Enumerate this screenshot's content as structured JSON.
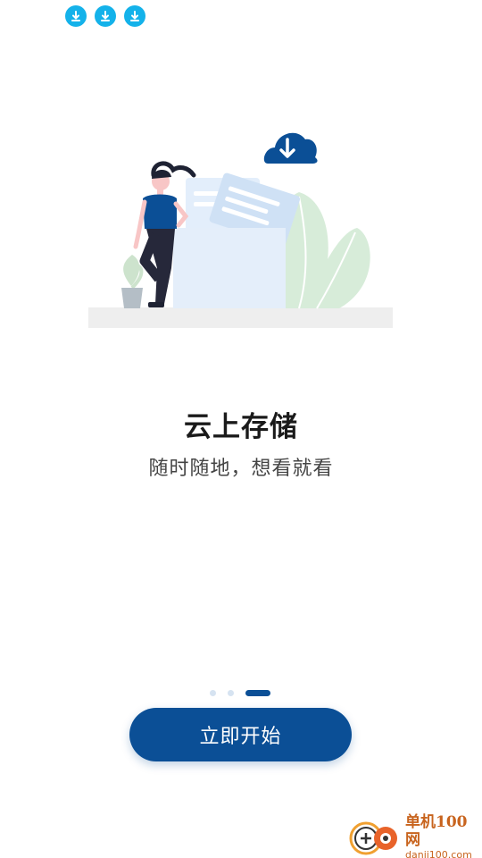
{
  "status_bar": {
    "icons": [
      "download-notification-icon",
      "download-notification-icon",
      "download-notification-icon"
    ]
  },
  "onboarding": {
    "title": "云上存储",
    "subtitle": "随时随地，想看就看",
    "page_indicator": {
      "count": 3,
      "active_index": 2
    },
    "start_button_label": "立即开始"
  },
  "watermark": {
    "main": "单机100网",
    "url": "danji100.com"
  },
  "colors": {
    "accent": "#0b4f96",
    "notif": "#14b2ea",
    "watermark": "#c8641e"
  }
}
